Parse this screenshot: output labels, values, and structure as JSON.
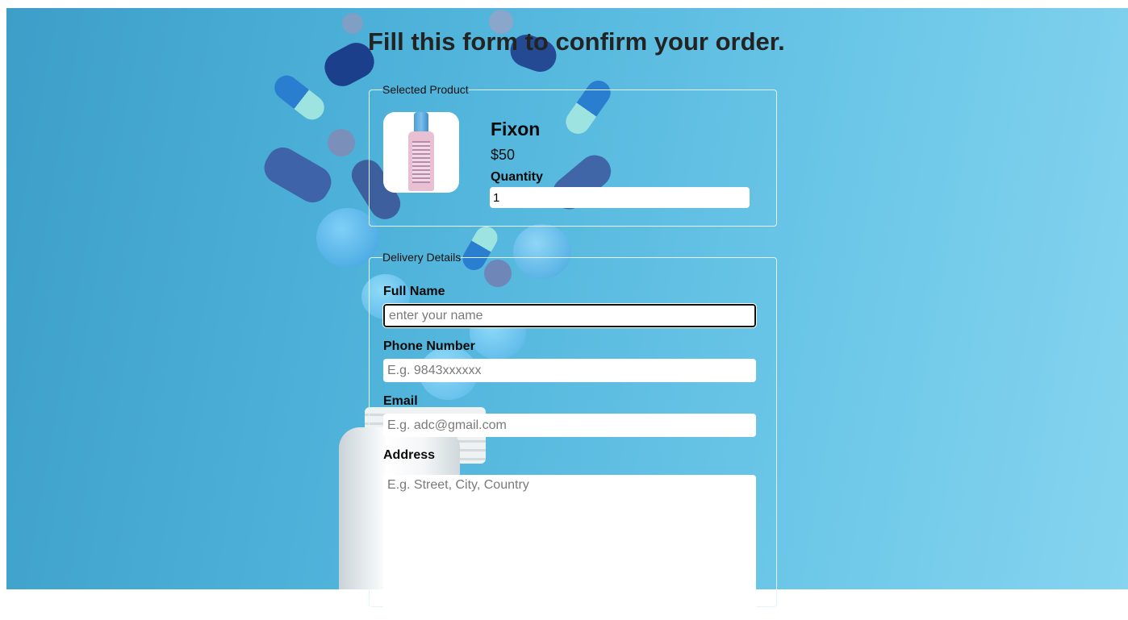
{
  "page": {
    "title": "Fill this form to confirm your order."
  },
  "product_section": {
    "legend": "Selected Product",
    "product_name": "Fixon",
    "price": "$50",
    "quantity_label": "Quantity",
    "quantity_value": "1"
  },
  "delivery_section": {
    "legend": "Delivery Details",
    "full_name": {
      "label": "Full Name",
      "placeholder": "enter your name",
      "value": ""
    },
    "phone": {
      "label": "Phone Number",
      "placeholder": "E.g. 9843xxxxxx",
      "value": ""
    },
    "email": {
      "label": "Email",
      "placeholder": "E.g. adc@gmail.com",
      "value": ""
    },
    "address": {
      "label": "Address",
      "placeholder": "E.g. Street, City, Country",
      "value": ""
    }
  },
  "icons": {
    "product_image": "medicine-bottle-image"
  },
  "colors": {
    "background_accent": "#5ebee2",
    "title_text": "#232323",
    "fieldset_border": "#e6f3f8"
  }
}
